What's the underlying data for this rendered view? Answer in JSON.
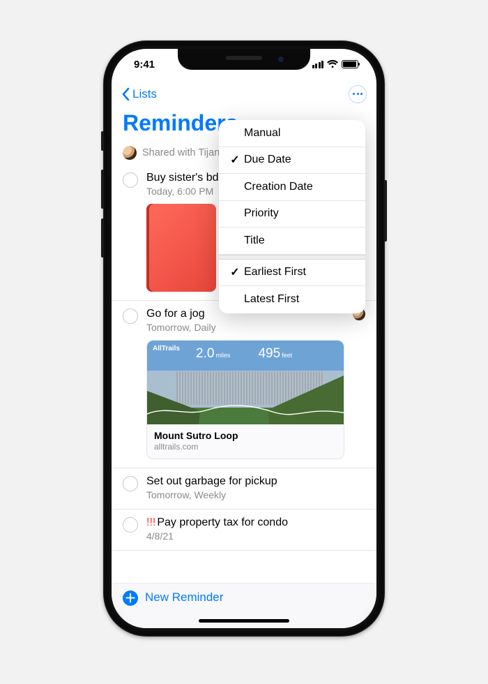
{
  "statusbar": {
    "time": "9:41"
  },
  "nav": {
    "back_label": "Lists"
  },
  "title": "Reminders",
  "shared_with": "Shared with Tijana",
  "sort_menu": {
    "group1": [
      {
        "label": "Manual",
        "checked": false
      },
      {
        "label": "Due Date",
        "checked": true
      },
      {
        "label": "Creation Date",
        "checked": false
      },
      {
        "label": "Priority",
        "checked": false
      },
      {
        "label": "Title",
        "checked": false
      }
    ],
    "group2": [
      {
        "label": "Earliest First",
        "checked": true
      },
      {
        "label": "Latest First",
        "checked": false
      }
    ]
  },
  "reminders": [
    {
      "title": "Buy sister's bday present",
      "subtitle": "Today, 6:00 PM",
      "attachment": "red-case"
    },
    {
      "title": "Go for a jog",
      "subtitle": "Tomorrow, Daily",
      "shared_avatar": true,
      "card": {
        "brand": "AllTrails",
        "stat1_value": "2.0",
        "stat1_unit": "miles",
        "stat2_value": "495",
        "stat2_unit": "feet",
        "title": "Mount Sutro Loop",
        "source": "alltrails.com"
      }
    },
    {
      "title": "Set out garbage for pickup",
      "subtitle": "Tomorrow, Weekly"
    },
    {
      "priority": "!!!",
      "title": "Pay property tax for condo",
      "subtitle": "4/8/21"
    }
  ],
  "bottom": {
    "new_label": "New Reminder"
  }
}
